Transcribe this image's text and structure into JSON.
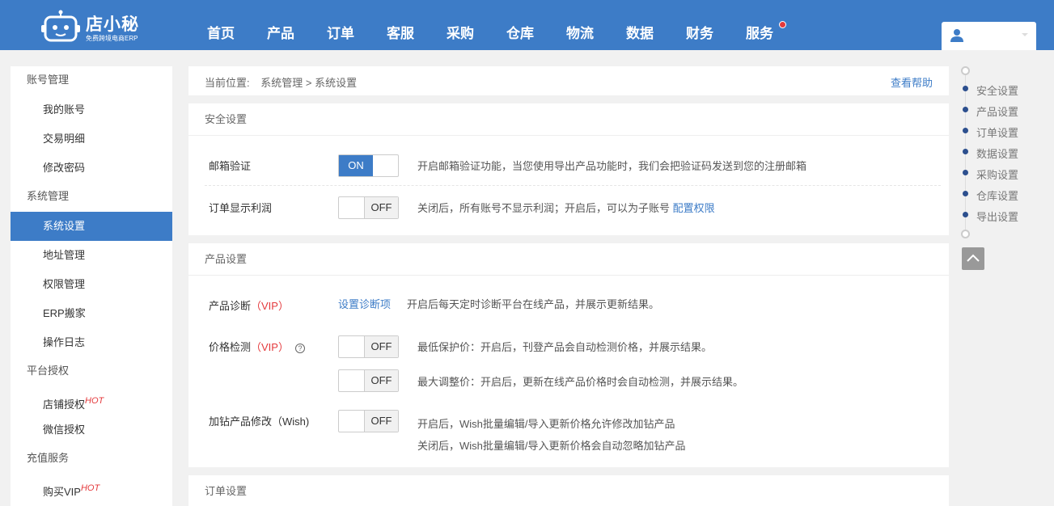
{
  "header": {
    "logo_text": "店小秘",
    "logo_sub": "免费跨境电商ERP",
    "nav": [
      {
        "label": "首页"
      },
      {
        "label": "产品"
      },
      {
        "label": "订单"
      },
      {
        "label": "客服"
      },
      {
        "label": "采购"
      },
      {
        "label": "仓库"
      },
      {
        "label": "物流"
      },
      {
        "label": "数据"
      },
      {
        "label": "财务"
      },
      {
        "label": "服务"
      }
    ]
  },
  "sidebar": {
    "groups": [
      {
        "title": "账号管理",
        "items": [
          {
            "label": "我的账号"
          },
          {
            "label": "交易明细"
          },
          {
            "label": "修改密码"
          }
        ]
      },
      {
        "title": "系统管理",
        "items": [
          {
            "label": "系统设置"
          },
          {
            "label": "地址管理"
          },
          {
            "label": "权限管理"
          },
          {
            "label": "ERP搬家"
          },
          {
            "label": "操作日志"
          }
        ]
      },
      {
        "title": "平台授权",
        "items": [
          {
            "label": "店铺授权",
            "badge": "HOT"
          },
          {
            "label": "微信授权"
          }
        ]
      },
      {
        "title": "充值服务",
        "items": [
          {
            "label": "购买VIP",
            "badge": "HOT"
          }
        ]
      }
    ]
  },
  "breadcrumb": {
    "prefix": "当前位置:",
    "path": "系统管理 > 系统设置",
    "help": "查看帮助"
  },
  "security": {
    "title": "安全设置",
    "email_label": "邮箱验证",
    "email_toggle": "ON",
    "email_desc": "开启邮箱验证功能，当您使用导出产品功能时，我们会把验证码发送到您的注册邮箱",
    "profit_label": "订单显示利润",
    "profit_toggle": "OFF",
    "profit_desc": "关闭后，所有账号不显示利润；开启后，可以为子账号",
    "profit_link": "配置权限"
  },
  "product": {
    "title": "产品设置",
    "diag_label": "产品诊断",
    "diag_vip": "（VIP）",
    "diag_link": "设置诊断项",
    "diag_desc": "开启后每天定时诊断平台在线产品，并展示更新结果。",
    "price_label": "价格检测",
    "price_vip": "（VIP）",
    "price_help": "?",
    "price_toggle1": "OFF",
    "price_desc1": "最低保护价：开启后，刊登产品会自动检测价格，并展示结果。",
    "price_toggle2": "OFF",
    "price_desc2": "最大调整价：开启后，更新在线产品价格时会自动检测，并展示结果。",
    "diamond_label": "加钻产品修改（Wish)",
    "diamond_toggle": "OFF",
    "diamond_desc1": "开启后，Wish批量编辑/导入更新价格允许修改加钻产品",
    "diamond_desc2": "关闭后，Wish批量编辑/导入更新价格会自动忽略加钻产品"
  },
  "order": {
    "title": "订单设置"
  },
  "anchor_nav": {
    "items": [
      {
        "label": "安全设置"
      },
      {
        "label": "产品设置"
      },
      {
        "label": "订单设置"
      },
      {
        "label": "数据设置"
      },
      {
        "label": "采购设置"
      },
      {
        "label": "仓库设置"
      },
      {
        "label": "导出设置"
      }
    ]
  },
  "colors": {
    "primary": "#3d7cc7",
    "danger": "#e4393c",
    "anchor_dot": "#2c4f8e"
  }
}
